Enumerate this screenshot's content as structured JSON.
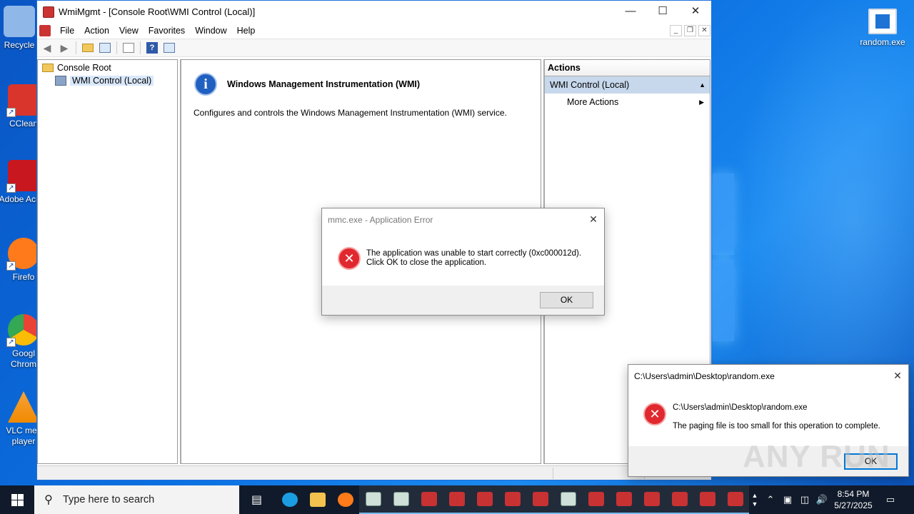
{
  "desktop": {
    "icons": [
      {
        "label": "Recycle",
        "icon": "recycle-bin-icon",
        "color": "#8fb8e8"
      },
      {
        "label": "CClean",
        "icon": "ccleaner-icon",
        "color": "#d9352c"
      },
      {
        "label": "Adobe Acrob",
        "icon": "adobe-acrobat-icon",
        "color": "#c8171e"
      },
      {
        "label": "Firefo",
        "icon": "firefox-icon",
        "color": "#ff7a1a"
      },
      {
        "label": "Googl Chrom",
        "icon": "chrome-icon",
        "color": "#34a853"
      },
      {
        "label": "VLC mec player",
        "icon": "vlc-icon",
        "color": "#f08a00"
      }
    ],
    "right_icon": {
      "label": "random.exe",
      "icon": "exe-file-icon"
    }
  },
  "mmc": {
    "title": "WmiMgmt - [Console Root\\WMI Control (Local)]",
    "menus": [
      "File",
      "Action",
      "View",
      "Favorites",
      "Window",
      "Help"
    ],
    "tree": {
      "root": "Console Root",
      "child": "WMI Control (Local)"
    },
    "center": {
      "heading": "Windows Management Instrumentation (WMI)",
      "description": "Configures and controls the Windows Management Instrumentation (WMI) service."
    },
    "actions": {
      "header": "Actions",
      "section": "WMI Control (Local)",
      "more": "More Actions"
    }
  },
  "error_dialog": {
    "title": "mmc.exe - Application Error",
    "line1": "The application was unable to start correctly (0xc000012d).",
    "line2": "Click OK to close the application.",
    "ok": "OK"
  },
  "paging_dialog": {
    "title": "C:\\Users\\admin\\Desktop\\random.exe",
    "path": "C:\\Users\\admin\\Desktop\\random.exe",
    "message": "The paging file is too small for this operation to complete.",
    "ok": "OK"
  },
  "watermark": "ANY RUN",
  "taskbar": {
    "search_placeholder": "Type here to search",
    "time": "8:54 PM",
    "date": "5/27/2025",
    "apps": [
      {
        "name": "task-view-button",
        "color": "transparent"
      },
      {
        "name": "edge-button",
        "color": "#1b9de2"
      },
      {
        "name": "file-explorer-button",
        "color": "#f2c14e"
      },
      {
        "name": "firefox-button",
        "color": "#ff7a1a"
      },
      {
        "name": "wmimgmt-button-1",
        "color": "#cfe0d8"
      },
      {
        "name": "wmimgmt-button-2",
        "color": "#cfe0d8"
      },
      {
        "name": "mmc-button-1",
        "color": "#c83232"
      },
      {
        "name": "mmc-button-2",
        "color": "#c83232"
      },
      {
        "name": "mmc-button-3",
        "color": "#c83232"
      },
      {
        "name": "mmc-button-4",
        "color": "#c83232"
      },
      {
        "name": "mmc-button-5",
        "color": "#c83232"
      },
      {
        "name": "wmimgmt-button-3",
        "color": "#cfe0d8"
      },
      {
        "name": "mmc-button-6",
        "color": "#c83232"
      },
      {
        "name": "mmc-button-7",
        "color": "#c83232"
      },
      {
        "name": "mmc-button-8",
        "color": "#c83232"
      },
      {
        "name": "mmc-button-9",
        "color": "#c83232"
      },
      {
        "name": "mmc-button-10",
        "color": "#c83232"
      },
      {
        "name": "mmc-button-11",
        "color": "#c83232"
      }
    ]
  }
}
